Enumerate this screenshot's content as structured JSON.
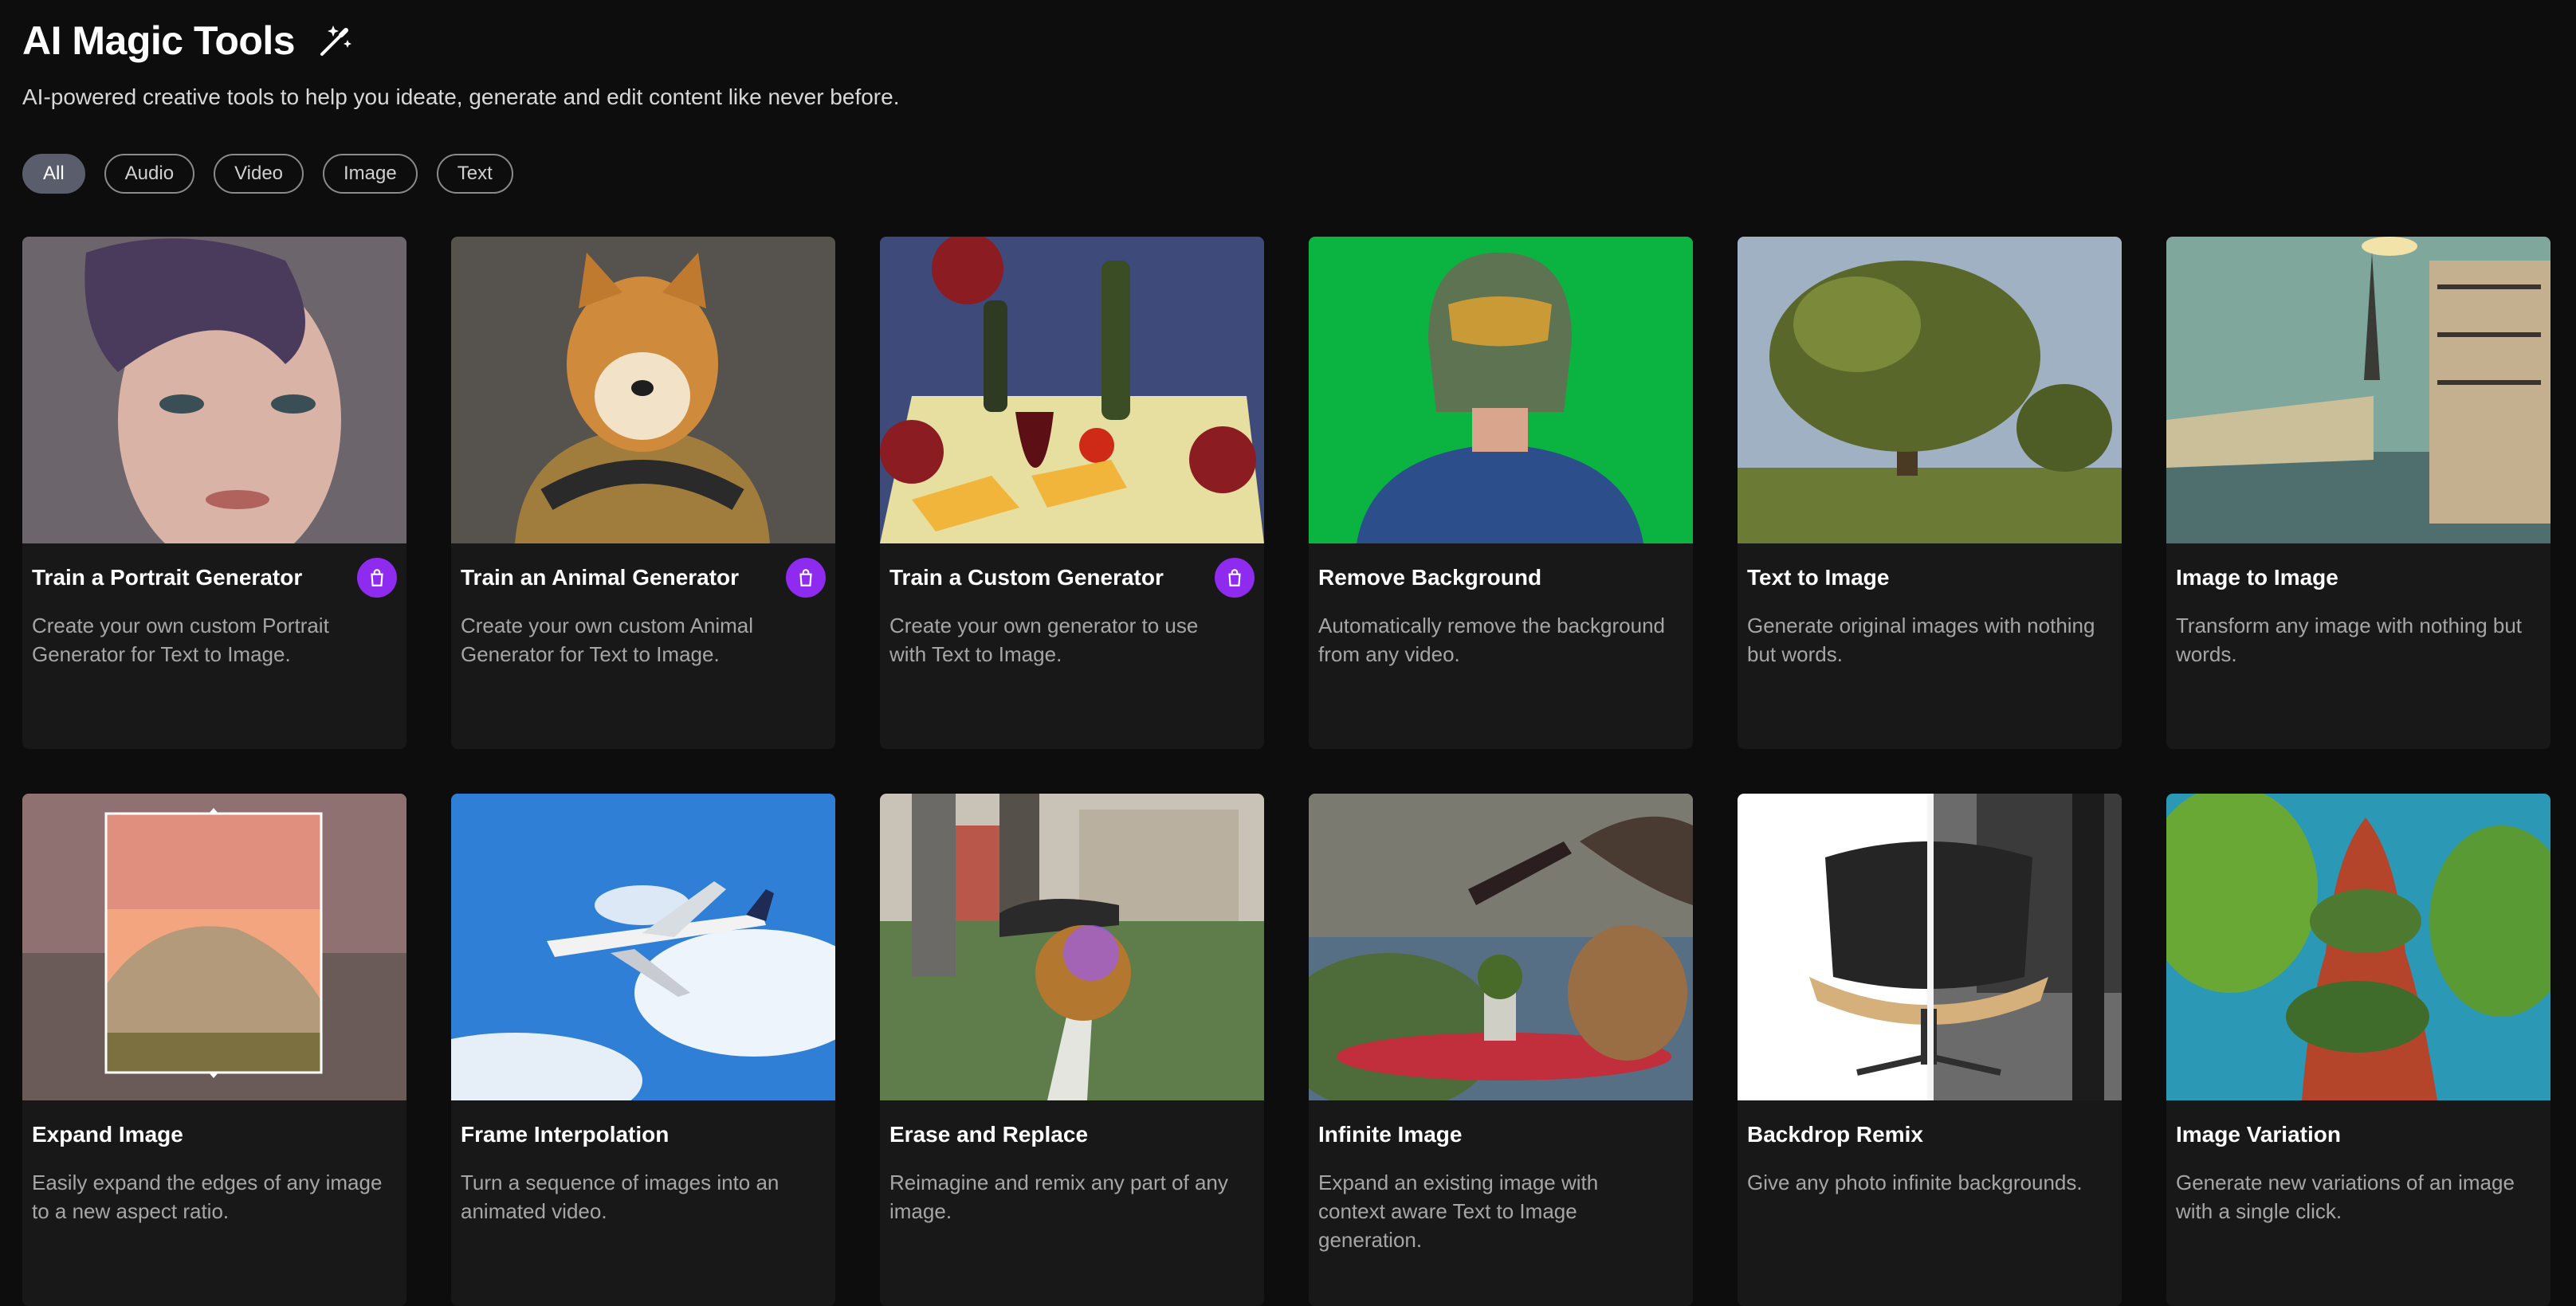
{
  "header": {
    "title": "AI Magic Tools",
    "title_icon": "magic-wand-icon",
    "subtitle": "AI-powered creative tools to help you ideate, generate and edit content like never before."
  },
  "filters": [
    "All",
    "Audio",
    "Video",
    "Image",
    "Text"
  ],
  "active_filter": "All",
  "colors": {
    "background": "#0d0d0d",
    "card": "#181818",
    "accent_purple": "#8f2bef",
    "active_pill": "#5a5d6b"
  },
  "tools": [
    {
      "title": "Train a Portrait Generator",
      "description": "Create your own custom Portrait Generator for Text to Image.",
      "badge_icon": "shopping-bag-icon"
    },
    {
      "title": "Train an Animal Generator",
      "description": "Create your own custom Animal Generator for Text to Image.",
      "badge_icon": "shopping-bag-icon"
    },
    {
      "title": "Train a Custom Generator",
      "description": "Create your own generator to use with Text to Image.",
      "badge_icon": "shopping-bag-icon"
    },
    {
      "title": "Remove Background",
      "description": "Automatically remove the background from any video."
    },
    {
      "title": "Text to Image",
      "description": "Generate original images with nothing but words."
    },
    {
      "title": "Image to Image",
      "description": "Transform any image with nothing but words."
    },
    {
      "title": "Expand Image",
      "description": "Easily expand the edges of any image to a new aspect ratio."
    },
    {
      "title": "Frame Interpolation",
      "description": "Turn a sequence of images into an animated video."
    },
    {
      "title": "Erase and Replace",
      "description": "Reimagine and remix any part of any image."
    },
    {
      "title": "Infinite Image",
      "description": "Expand an existing image with context aware Text to Image generation."
    },
    {
      "title": "Backdrop Remix",
      "description": "Give any photo infinite backgrounds."
    },
    {
      "title": "Image Variation",
      "description": "Generate new variations of an image with a single click."
    }
  ]
}
